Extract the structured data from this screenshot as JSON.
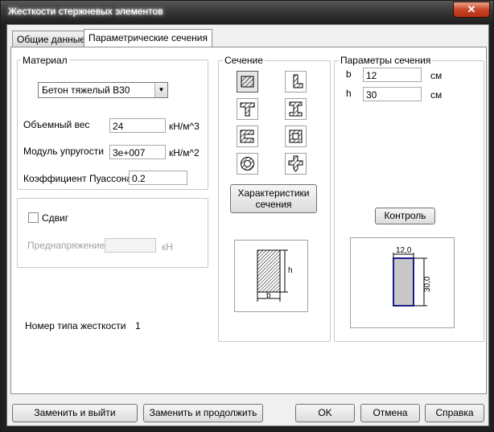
{
  "window": {
    "title": "Жесткости стержневых элементов",
    "close_label": "✕"
  },
  "tabs": [
    {
      "label": "Общие данные"
    },
    {
      "label": "Параметрические сечения"
    }
  ],
  "material": {
    "group_label": "Материал",
    "selected": "Бетон тяжелый B30",
    "weight_label": "Объемный вес",
    "weight_value": "24",
    "weight_unit": "кН/м^3",
    "modulus_label": "Модуль упругости",
    "modulus_value": "3e+007",
    "modulus_unit": "кН/м^2",
    "poisson_label": "Коэффициент Пуассона",
    "poisson_value": "0.2"
  },
  "shear": {
    "checkbox_label": "Сдвиг",
    "checked": false,
    "prestress_label": "Преднапряжение",
    "prestress_value": "",
    "prestress_unit": "кН"
  },
  "stiffness_type": {
    "label": "Номер типа жесткости",
    "value": "1"
  },
  "section": {
    "group_label": "Сечение",
    "shapes": [
      {
        "icon": "rectangle-section-icon"
      },
      {
        "icon": "angle-section-icon"
      },
      {
        "icon": "tee-section-icon"
      },
      {
        "icon": "i-beam-section-icon"
      },
      {
        "icon": "channel-section-icon"
      },
      {
        "icon": "box-section-icon"
      },
      {
        "icon": "ring-section-icon"
      },
      {
        "icon": "cross-section-icon"
      }
    ],
    "properties_button": "Характеристики сечения",
    "preview_b": "b",
    "preview_h": "h"
  },
  "params": {
    "group_label": "Параметры сечения",
    "b_label": "b",
    "b_value": "12",
    "b_unit": "см",
    "h_label": "h",
    "h_value": "30",
    "h_unit": "см",
    "control_button": "Контроль",
    "dim_width": "12,0",
    "dim_height": "30,0"
  },
  "footer": {
    "replace_exit": "Заменить и выйти",
    "replace_continue": "Заменить и продолжить",
    "ok": "OK",
    "cancel": "Отмена",
    "help": "Справка"
  }
}
